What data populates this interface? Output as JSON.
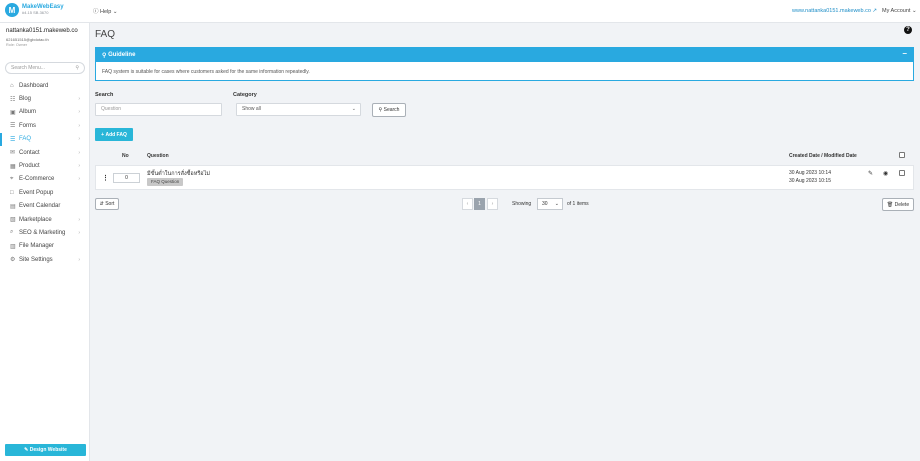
{
  "topbar": {
    "logo_title": "MakeWebEasy",
    "logo_sub": "#4.15 SB.3670",
    "help": "Help",
    "site_link": "www.nattanka0151.makeweb.co",
    "account": "My Account"
  },
  "user": {
    "name": "nattanka0151.makeweb.co",
    "email": "621651515@gbdotac.th",
    "role": "Role: Owner"
  },
  "sidebar": {
    "search_placeholder": "Search Menu...",
    "items": [
      {
        "label": "Dashboard",
        "icon": "home-icon",
        "has_children": false
      },
      {
        "label": "Blog",
        "icon": "blog-icon",
        "has_children": true
      },
      {
        "label": "Album",
        "icon": "album-icon",
        "has_children": true
      },
      {
        "label": "Forms",
        "icon": "forms-icon",
        "has_children": true
      },
      {
        "label": "FAQ",
        "icon": "faq-icon",
        "has_children": true,
        "active": true
      },
      {
        "label": "Contact",
        "icon": "contact-icon",
        "has_children": true
      },
      {
        "label": "Product",
        "icon": "product-icon",
        "has_children": true
      },
      {
        "label": "E-Commerce",
        "icon": "ecommerce-icon",
        "has_children": true
      },
      {
        "label": "Event Popup",
        "icon": "event-popup-icon",
        "has_children": false
      },
      {
        "label": "Event Calendar",
        "icon": "calendar-icon",
        "has_children": false
      },
      {
        "label": "Marketplace",
        "icon": "marketplace-icon",
        "has_children": true
      },
      {
        "label": "SEO & Marketing",
        "icon": "seo-icon",
        "has_children": true
      },
      {
        "label": "File Manager",
        "icon": "file-manager-icon",
        "has_children": false
      },
      {
        "label": "Site Settings",
        "icon": "settings-icon",
        "has_children": true
      }
    ],
    "design_button": "Design Website"
  },
  "main": {
    "title": "FAQ",
    "guide": {
      "title": "Guideline",
      "text": "FAQ system is suitable for cases where customers asked for the same information repeatedly."
    },
    "filters": {
      "search_label": "Search",
      "search_placeholder": "Question",
      "category_label": "Category",
      "category_value": "Show all",
      "search_button": "Search"
    },
    "add_button": "Add FAQ",
    "table": {
      "col_no": "No",
      "col_question": "Question",
      "col_date": "Created Date / Modified Date",
      "rows": [
        {
          "order": "0",
          "question": "มีขั้นต่ำในการสั่งซื้อหรือไม่",
          "category": "FAQ Question",
          "created": "30 Aug 2023 10:14",
          "modified": "30 Aug 2023 10:15"
        }
      ]
    },
    "footer": {
      "sort_button": "Sort",
      "prev": "‹",
      "current_page": "1",
      "next": "›",
      "showing_label": "Showing",
      "per_page": "30",
      "of_items": "of 1 items",
      "delete_button": "Delete"
    }
  },
  "colors": {
    "accent": "#29a9e0",
    "button": "#29b6d8"
  }
}
